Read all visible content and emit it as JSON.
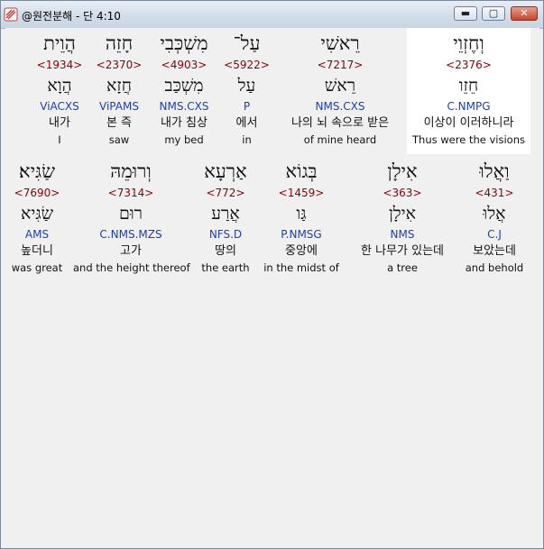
{
  "window": {
    "title": "@원전분해 - 단 4:10",
    "controls": {
      "minimize": "▬",
      "maximize": "▢",
      "close": "✕"
    },
    "colors": {
      "strong": "#8b0000",
      "morph": "#1a3fb5"
    }
  },
  "rows": [
    {
      "words": [
        {
          "heb": "הֲוֵית",
          "strong": "<1934>",
          "lemma": "הֲוָא",
          "morph": "ViACXS",
          "kor": "내가",
          "eng": "I"
        },
        {
          "heb": "חָזֵה",
          "strong": "<2370>",
          "lemma": "חֲזָא",
          "morph": "ViPAMS",
          "kor": "본 즉",
          "eng": "saw"
        },
        {
          "heb": "מִשְׁכְּבִי",
          "strong": "<4903>",
          "lemma": "מִשְׁכַּב",
          "morph": "NMS.CXS",
          "kor": "내가 침상",
          "eng": "my bed"
        },
        {
          "heb": "עַל־",
          "strong": "<5922>",
          "lemma": "עַל",
          "morph": "P",
          "kor": "에서",
          "eng": "in"
        },
        {
          "heb": "רֵאשִׁי",
          "strong": "<7217>",
          "lemma": "רֵאשׁ",
          "morph": "NMS.CXS",
          "kor": "나의 뇌 속으로 받은",
          "eng": "of mine heard"
        },
        {
          "heb": "וְחֶזְוֵי",
          "strong": "<2376>",
          "lemma": "חֵזֵו",
          "morph": "C.NMPG",
          "kor": "이상이 이러하니라",
          "eng": "Thus were the visions"
        }
      ]
    },
    {
      "words": [
        {
          "heb": "שַׂגִּיא׃",
          "strong": "<7690>",
          "lemma": "שַׂגִּיא",
          "morph": "AMS",
          "kor": "높더니",
          "eng": "was great"
        },
        {
          "heb": "וְרוּמֵהּ",
          "strong": "<7314>",
          "lemma": "רוּם",
          "morph": "C.NMS.MZS",
          "kor": "고가",
          "eng": "and the height thereof"
        },
        {
          "heb": "אַרְעָא",
          "strong": "<772>",
          "lemma": "אֲרַע",
          "morph": "NFS.D",
          "kor": "땅의",
          "eng": "the earth"
        },
        {
          "heb": "בְּגוֹא",
          "strong": "<1459>",
          "lemma": "גַּו",
          "morph": "P.NMSG",
          "kor": "중앙에",
          "eng": "in the midst of"
        },
        {
          "heb": "אִילָן",
          "strong": "<363>",
          "lemma": "אִילָן",
          "morph": "NMS",
          "kor": "한 나무가 있는데",
          "eng": "a tree"
        },
        {
          "heb": "וַאֲלוּ",
          "strong": "<431>",
          "lemma": "אֲלוּ",
          "morph": "C.J",
          "kor": "보았는데",
          "eng": "and behold"
        }
      ]
    }
  ]
}
